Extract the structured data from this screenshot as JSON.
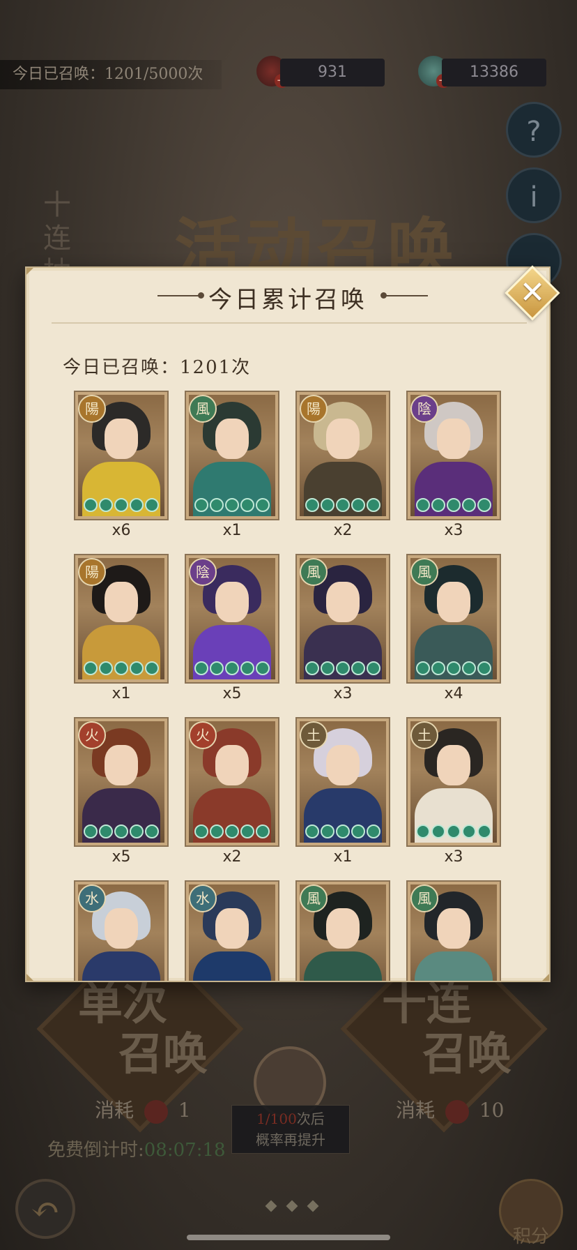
{
  "background": {
    "summon_count_text": "今日已召唤：1201/5000次",
    "resources": [
      {
        "name": "scroll-icon",
        "value": "931"
      },
      {
        "name": "jade-icon",
        "value": "13386"
      }
    ],
    "side_buttons": [
      "?",
      "i",
      ""
    ],
    "vertical_title": "十连抽",
    "event_title": "活动召唤",
    "single_summon": {
      "line1": "单次",
      "line2": "召唤",
      "cost_label": "消耗",
      "cost_value": "1"
    },
    "ten_summon": {
      "line1": "十连",
      "line2": "召唤",
      "cost_label": "消耗",
      "cost_value": "10"
    },
    "free_timer_label": "免费倒计时:",
    "free_timer_value": "08:07:18",
    "prob_line1_hl": "1/100",
    "prob_line1_rest": "次后",
    "prob_line2": "概率再提升",
    "points_label": "积分"
  },
  "modal": {
    "title": "今日累计召唤",
    "today_label": "今日已召唤：1201次",
    "cards": [
      {
        "badge": "陽",
        "element": "yang",
        "qty": "x6"
      },
      {
        "badge": "風",
        "element": "wind",
        "qty": "x1"
      },
      {
        "badge": "陽",
        "element": "yang",
        "qty": "x2"
      },
      {
        "badge": "陰",
        "element": "yin",
        "qty": "x3"
      },
      {
        "badge": "陽",
        "element": "yang",
        "qty": "x1"
      },
      {
        "badge": "陰",
        "element": "yin",
        "qty": "x5"
      },
      {
        "badge": "風",
        "element": "wind",
        "qty": "x3"
      },
      {
        "badge": "風",
        "element": "wind",
        "qty": "x4"
      },
      {
        "badge": "火",
        "element": "fire",
        "qty": "x5"
      },
      {
        "badge": "火",
        "element": "fire",
        "qty": "x2"
      },
      {
        "badge": "土",
        "element": "earth",
        "qty": "x1"
      },
      {
        "badge": "土",
        "element": "earth",
        "qty": "x3"
      },
      {
        "badge": "水",
        "element": "water",
        "qty": ""
      },
      {
        "badge": "水",
        "element": "water",
        "qty": ""
      },
      {
        "badge": "風",
        "element": "wind",
        "qty": ""
      },
      {
        "badge": "風",
        "element": "wind",
        "qty": ""
      }
    ],
    "stars_per_card": 5
  },
  "colors": {
    "yang": "#a8752c",
    "yin": "#6b3f8a",
    "wind": "#3f7a55",
    "fire": "#a3402c",
    "earth": "#6e5a3a",
    "water": "#3e6e78",
    "star": "#2f8a6c"
  }
}
